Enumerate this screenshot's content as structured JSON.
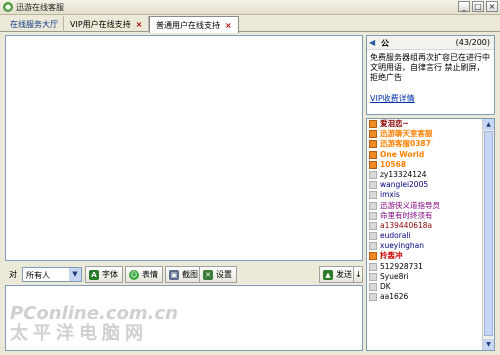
{
  "window": {
    "title": "迅游在线客服",
    "min": "_",
    "max": "□",
    "close": "×"
  },
  "tabs": [
    {
      "label": "在线服务大厅",
      "closable": false
    },
    {
      "label": "VIP用户在线支持",
      "close": "×"
    },
    {
      "label": "普通用户在线支持",
      "close": "×"
    }
  ],
  "toolbar": {
    "to_label": "对",
    "recipient": "所有人",
    "font": "字体",
    "emoji": "表情",
    "screenshot": "截图",
    "settings": "设置",
    "send": "发送",
    "send_arrow": "↓"
  },
  "notice": {
    "name": "公",
    "count": "(43/200)",
    "text": "免费服务器组再次扩容已在进行中 文明用语，自律言行 禁止刷屏，拒绝广告",
    "link": "VIP收费详情"
  },
  "users": [
    {
      "name": "爱泪恋~",
      "color": "#8b0000",
      "hl": true
    },
    {
      "name": "迅游聊天室客服",
      "color": "#ff7f00",
      "hl": true
    },
    {
      "name": "迅游客服0387",
      "color": "#ff7f00",
      "hl": true
    },
    {
      "name": "One World",
      "color": "#ff7f00",
      "hl": true
    },
    {
      "name": "10568",
      "color": "#ff7f00",
      "hl": true
    },
    {
      "name": "zy13324124",
      "color": "#000000",
      "hl": false
    },
    {
      "name": "wanglei2005",
      "color": "#000080",
      "hl": false
    },
    {
      "name": "imxis",
      "color": "#000080",
      "hl": false
    },
    {
      "name": "迅游侠义道指导员",
      "color": "#800080",
      "hl": false
    },
    {
      "name": "命里有时终须有",
      "color": "#800080",
      "hl": false
    },
    {
      "name": "a139440618a",
      "color": "#8b0000",
      "hl": false
    },
    {
      "name": "eudorali",
      "color": "#000080",
      "hl": false
    },
    {
      "name": "xueyinghan",
      "color": "#000080",
      "hl": false
    },
    {
      "name": "拎轰冲",
      "color": "#cc0000",
      "hl": true
    },
    {
      "name": "512928731",
      "color": "#000000",
      "hl": false
    },
    {
      "name": "Syue8ri",
      "color": "#000000",
      "hl": false
    },
    {
      "name": "DK",
      "color": "#000000",
      "hl": false
    },
    {
      "name": "aa1626",
      "color": "#000000",
      "hl": false
    }
  ],
  "watermark": {
    "line1": "PConline.com.cn",
    "line2": "太平洋电脑网"
  },
  "colors": {
    "accent": "#0a3a8a",
    "close": "#b00000",
    "link": "#0033aa"
  }
}
